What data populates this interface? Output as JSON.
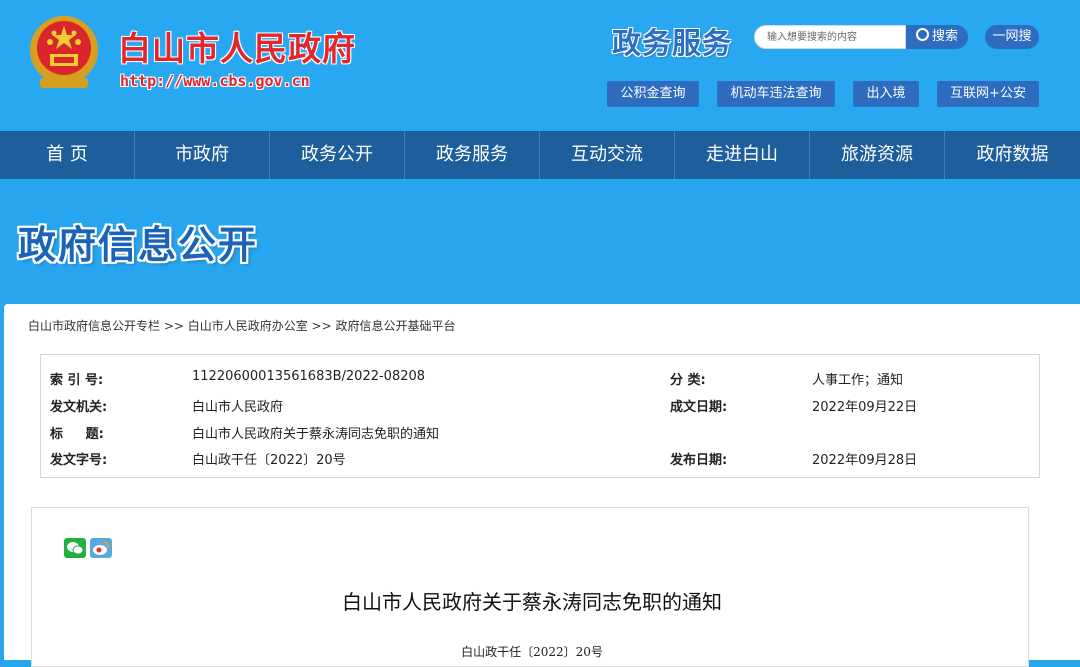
{
  "header": {
    "site_title": "白山市人民政府",
    "site_url": "http://www.cbs.gov.cn",
    "services_title": "政务服务",
    "search_placeholder": "输入想要搜索的内容",
    "search_button": "搜索",
    "yiwang_button": "一网搜",
    "quick_links": [
      "公积金查询",
      "机动车违法查询",
      "出入境",
      "互联网+公安"
    ]
  },
  "nav": {
    "items": [
      "首 页",
      "市政府",
      "政务公开",
      "政务服务",
      "互动交流",
      "走进白山",
      "旅游资源",
      "政府数据"
    ]
  },
  "banner": {
    "title": "政府信息公开"
  },
  "breadcrumb": "白山市政府信息公开专栏 >> 白山市人民政府办公室 >> 政府信息公开基础平台",
  "info": {
    "index_label": "索 引 号:",
    "index_value": "11220600013561683B/2022-08208",
    "category_label": "分  类:",
    "category_value": "人事工作；通知",
    "issuer_label": "发文机关:",
    "issuer_value": "白山市人民政府",
    "date_label": "成文日期:",
    "date_value": "2022年09月22日",
    "title_label": "标     题:",
    "title_value": "白山市人民政府关于蔡永涛同志免职的通知",
    "docno_label": "发文字号:",
    "docno_value": "白山政干任〔2022〕20号",
    "publish_label": "发布日期:",
    "publish_value": "2022年09月28日"
  },
  "article": {
    "title": "白山市人民政府关于蔡永涛同志免职的通知",
    "doc_number": "白山政干任〔2022〕20号"
  },
  "colors": {
    "page_bg": "#27a5ef",
    "nav_bg": "#1d5f9d",
    "button_bg": "#2e6cc0",
    "brand_red": "#e3262d"
  }
}
